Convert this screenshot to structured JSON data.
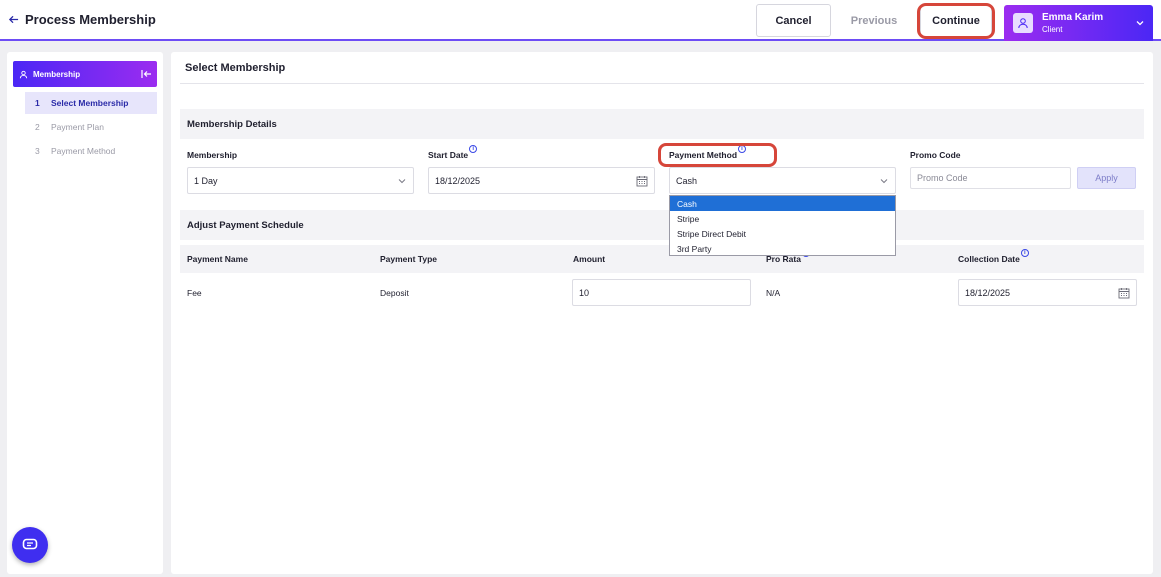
{
  "header": {
    "title": "Process Membership",
    "cancel_label": "Cancel",
    "previous_label": "Previous",
    "continue_label": "Continue",
    "user_name": "Emma Karim",
    "user_role": "Client"
  },
  "sidebar": {
    "heading": "Membership",
    "steps": [
      {
        "num": "1",
        "label": "Select Membership"
      },
      {
        "num": "2",
        "label": "Payment Plan"
      },
      {
        "num": "3",
        "label": "Payment Method"
      }
    ]
  },
  "main": {
    "title": "Select Membership",
    "details_heading": "Membership Details",
    "membership_label": "Membership",
    "membership_value": "1 Day",
    "start_date_label": "Start Date",
    "start_date_value": "18/12/2025",
    "payment_method_label": "Payment Method",
    "payment_method_value": "Cash",
    "payment_method_options": [
      "Cash",
      "Stripe",
      "Stripe Direct Debit",
      "3rd Party"
    ],
    "promo_label": "Promo Code",
    "promo_placeholder": "Promo Code",
    "apply_label": "Apply",
    "schedule_heading": "Adjust Payment Schedule",
    "table": {
      "headers": [
        "Payment Name",
        "Payment Type",
        "Amount",
        "Pro Rata",
        "Collection Date"
      ],
      "row": {
        "name": "Fee",
        "type": "Deposit",
        "amount": "10",
        "pro_rata": "N/A",
        "collection_date": "18/12/2025"
      }
    }
  },
  "colors": {
    "accent": "#4b27f5",
    "accent2": "#9b2cf0",
    "highlight": "#d6463a",
    "selected_option": "#1f6fd6"
  }
}
